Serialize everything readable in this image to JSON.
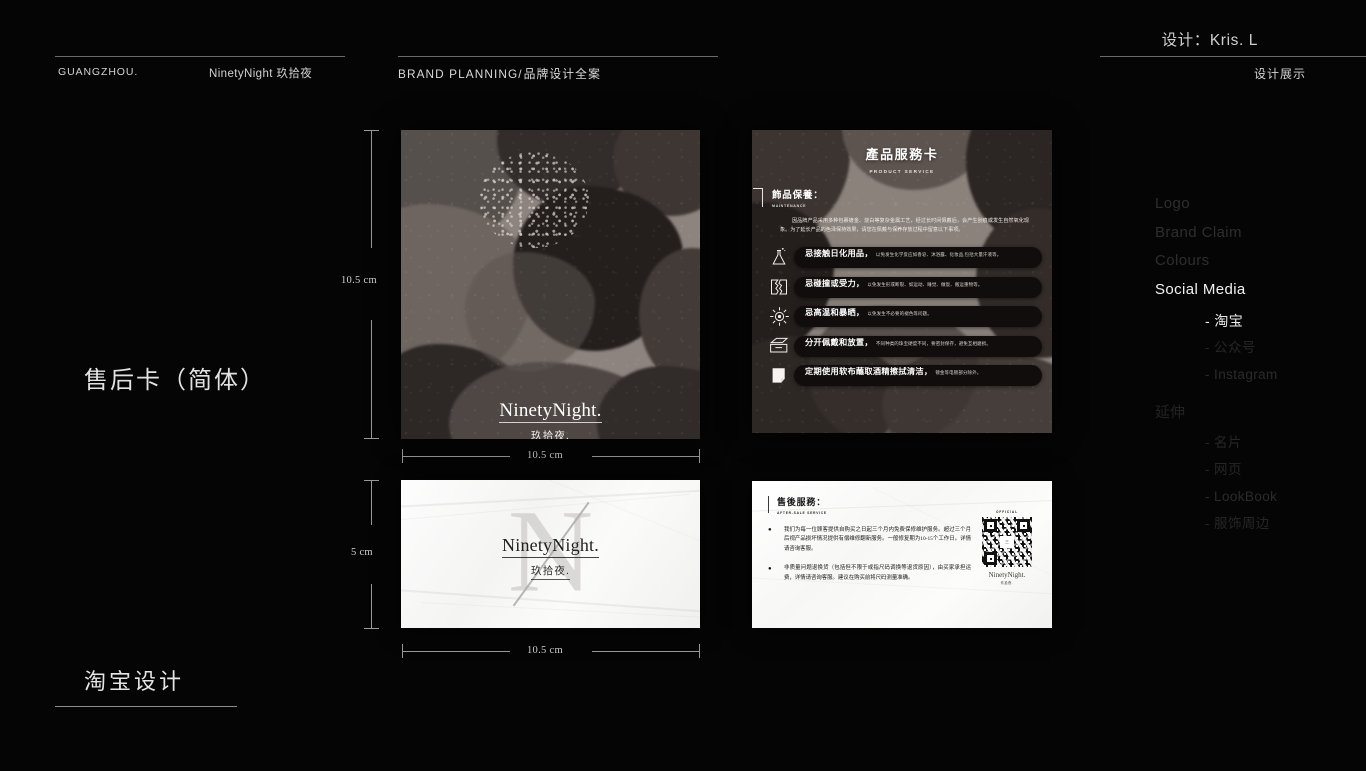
{
  "header": {
    "designer": "设计：Kris. L",
    "city": "GUANGZHOU.",
    "brand": "NinetyNight 玖拾夜",
    "planning_en": "BRAND  PLANNING",
    "planning_sep": "/",
    "planning_cn": "品牌设计全案",
    "show": "设计展示"
  },
  "left": {
    "title": "售后卡（简体）",
    "subtitle": "淘宝设计"
  },
  "nav": {
    "items": [
      {
        "label": "Logo",
        "state": "dim"
      },
      {
        "label": "Brand Claim",
        "state": "dim"
      },
      {
        "label": "Colours",
        "state": "dim"
      },
      {
        "label": "Social Media",
        "state": "active"
      }
    ],
    "sub_items": [
      {
        "label": "- 淘宝",
        "state": "active"
      },
      {
        "label": "- 公众号",
        "state": "d1"
      },
      {
        "label": "- Instagram",
        "state": "d2"
      }
    ],
    "group_title": "延伸",
    "group_items": [
      {
        "label": "- 名片",
        "state": "d1"
      },
      {
        "label": "- 网页",
        "state": "d1"
      },
      {
        "label": "- LookBook",
        "state": "d2"
      },
      {
        "label": "- 服饰周边",
        "state": "d1"
      }
    ]
  },
  "dimensions": {
    "main_height": "10.5 cm",
    "main_width": "10.5 cm",
    "small_height": "5 cm",
    "small_width": "10.5 cm"
  },
  "logo": {
    "word": "NinetyNight.",
    "cn": "玖拾夜.",
    "watermark": "N"
  },
  "service_card": {
    "title": "產品服務卡",
    "title_en": "PRODUCT   SERVICE",
    "section_title": "飾品保養：",
    "section_en": "MAINTENANCE",
    "paragraph": "因品牌产品采用多种包裹镀金、烧白等复杂金属工艺，经过长时间佩戴后，会产生刮痕或发生自然氧化现象。为了延长产品的色泽保持效果，请您在佩戴与保养存放过程中留意以下事项。",
    "items": [
      {
        "icon": "flask-icon",
        "title": "忌接触日化用品，",
        "desc": "以免发生化学反应如香皂、沐浴露、化妆品,包括大量汗液等。"
      },
      {
        "icon": "crack-icon",
        "title": "忌碰撞或受力，",
        "desc": "以免发生形或断裂、如运动、睡觉、做饭、搬运重物等。"
      },
      {
        "icon": "sun-icon",
        "title": "忌高温和暴晒，",
        "desc": "以免发生不必要的褪色等问题。"
      },
      {
        "icon": "drawer-icon",
        "title": "分开佩戴和放置，",
        "desc": "不同种类的珠宝硬度不同，要密封保存，避免互相磨损。"
      },
      {
        "icon": "cloth-icon",
        "title": "定期使用软布蘸取酒精擦拭清洁，",
        "desc": "镀金等电镀部分除外。"
      }
    ]
  },
  "after_sale_card": {
    "section_title": "售後服務：",
    "section_en": "AFTER-SALE SERVICE",
    "items": [
      "我们为每一位顾客提供自购买之日起三个月内免费保修维护服务。超过三个月后视产品损坏情况提供有偿维修翻新服务。一般修复期为10-15个工作日。详情请咨询客服。",
      "非质量问题退换货（包括但不限于或指尺码调换等退货原因），由买家承担运费，详情请咨询客服。建议在购买前将尺码测量准确。"
    ],
    "qr_caption": "OFFICIAL",
    "qr_center": "三",
    "qr_logo_word": "NinetyNight.",
    "qr_logo_cn": "玖拾夜."
  },
  "colors": {
    "background": "#050505",
    "card_dark": "#8d847f",
    "card_light": "#fbfbfa",
    "rule": "#6a6a6a",
    "accent_text": "#f2f2f2"
  }
}
